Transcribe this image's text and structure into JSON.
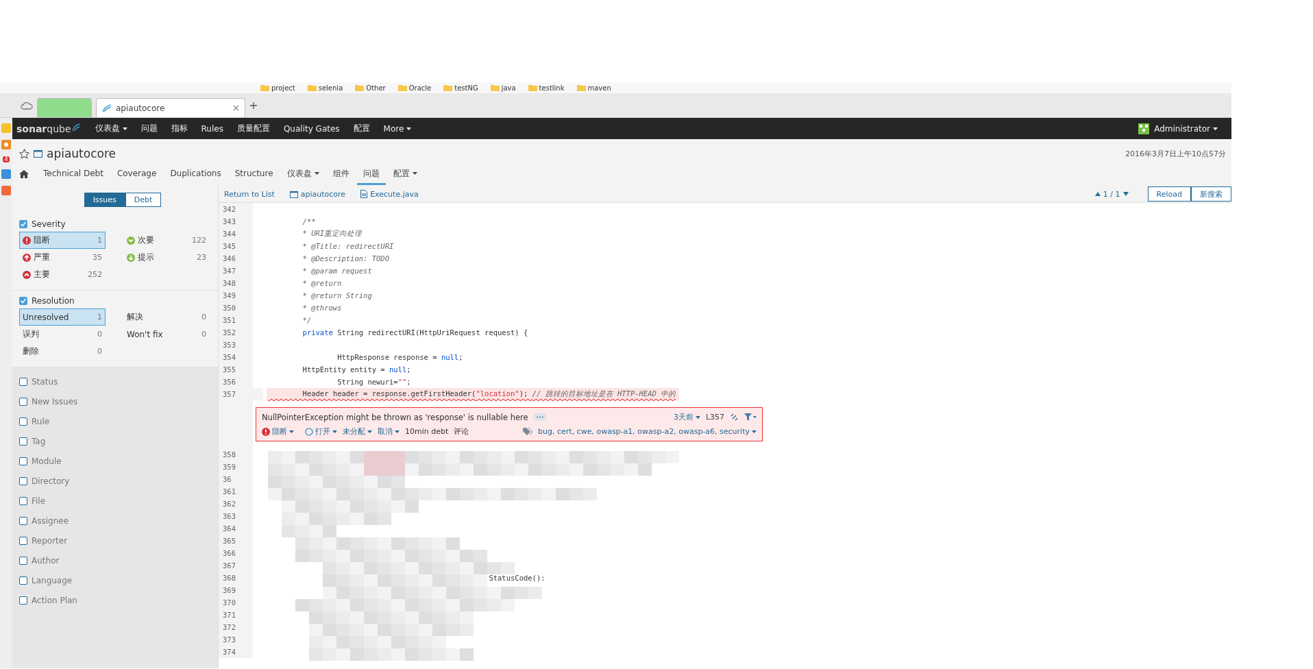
{
  "browser": {
    "bookmarks": [
      "project",
      "selenia",
      "Other",
      "Oracle",
      "testNG",
      "java",
      "testlink",
      "maven"
    ],
    "tabs": [
      {
        "selected": false
      },
      {
        "label": "apiautocore",
        "selected": true
      }
    ],
    "side_badge": "4"
  },
  "navbar": {
    "logo": "**sonar**qube",
    "items": [
      {
        "label": "仪表盘",
        "dropdown": true
      },
      {
        "label": "问题",
        "dropdown": false
      },
      {
        "label": "指标",
        "dropdown": false
      },
      {
        "label": "Rules",
        "dropdown": false
      },
      {
        "label": "质量配置",
        "dropdown": false
      },
      {
        "label": "Quality Gates",
        "dropdown": false
      },
      {
        "label": "配置",
        "dropdown": false
      },
      {
        "label": "More",
        "dropdown": true
      }
    ],
    "user": "Administrator"
  },
  "project": {
    "name": "apiautocore",
    "date": "2016年3月7日上午10点57分",
    "tabs": [
      {
        "label": "Technical Debt",
        "selected": false,
        "dropdown": false
      },
      {
        "label": "Coverage",
        "selected": false,
        "dropdown": false
      },
      {
        "label": "Duplications",
        "selected": false,
        "dropdown": false
      },
      {
        "label": "Structure",
        "selected": false,
        "dropdown": false
      },
      {
        "label": "仪表盘",
        "selected": false,
        "dropdown": true
      },
      {
        "label": "组件",
        "selected": false,
        "dropdown": false
      },
      {
        "label": "问题",
        "selected": true,
        "dropdown": false
      },
      {
        "label": "配置",
        "selected": false,
        "dropdown": true
      }
    ]
  },
  "sidebar": {
    "toggle": [
      {
        "label": "Issues",
        "selected": true
      },
      {
        "label": "Debt",
        "selected": false
      }
    ],
    "facets": [
      {
        "label": "Severity",
        "checked": true,
        "items": [
          {
            "label": "阻断",
            "count": "1",
            "selected": true,
            "kind": "blocker"
          },
          {
            "label": "次要",
            "count": "122",
            "selected": false,
            "kind": "minor"
          },
          {
            "label": "严重",
            "count": "35",
            "selected": false,
            "kind": "critical"
          },
          {
            "label": "提示",
            "count": "23",
            "selected": false,
            "kind": "info"
          },
          {
            "label": "主要",
            "count": "252",
            "selected": false,
            "kind": "major"
          }
        ]
      },
      {
        "label": "Resolution",
        "checked": true,
        "items": [
          {
            "label": "Unresolved",
            "count": "1",
            "selected": true
          },
          {
            "label": "解决",
            "count": "0",
            "selected": false
          },
          {
            "label": "误判",
            "count": "0",
            "selected": false
          },
          {
            "label": "Won't fix",
            "count": "0",
            "selected": false
          },
          {
            "label": "删除",
            "count": "0",
            "selected": false
          }
        ]
      },
      {
        "label": "Status",
        "checked": false
      },
      {
        "label": "New Issues",
        "checked": false
      },
      {
        "label": "Rule",
        "checked": false
      },
      {
        "label": "Tag",
        "checked": false
      },
      {
        "label": "Module",
        "checked": false
      },
      {
        "label": "Directory",
        "checked": false
      },
      {
        "label": "File",
        "checked": false
      },
      {
        "label": "Assignee",
        "checked": false
      },
      {
        "label": "Reporter",
        "checked": false
      },
      {
        "label": "Author",
        "checked": false
      },
      {
        "label": "Language",
        "checked": false
      },
      {
        "label": "Action Plan",
        "checked": false
      }
    ]
  },
  "toolbar": {
    "back": "Return to List",
    "project": "apiautocore",
    "file": "Execute.java",
    "pager": "1 / 1",
    "buttons": [
      "Reload",
      "新搜索"
    ]
  },
  "code": {
    "before": [
      {
        "number": "342"
      },
      {
        "number": "343",
        "tokens": [
          {
            "text": "        /**",
            "kind": "comment"
          }
        ]
      },
      {
        "number": "344",
        "tokens": [
          {
            "text": "        * URI重定向处理",
            "kind": "comment"
          }
        ]
      },
      {
        "number": "345",
        "tokens": [
          {
            "text": "        * @Title: redirectURI",
            "kind": "comment"
          }
        ]
      },
      {
        "number": "346",
        "tokens": [
          {
            "text": "        * @Description: TODO",
            "kind": "comment"
          }
        ]
      },
      {
        "number": "347",
        "tokens": [
          {
            "text": "        * @param request",
            "kind": "comment"
          }
        ]
      },
      {
        "number": "348",
        "tokens": [
          {
            "text": "        * @return",
            "kind": "comment"
          }
        ]
      },
      {
        "number": "349",
        "tokens": [
          {
            "text": "        * @return String",
            "kind": "comment"
          }
        ]
      },
      {
        "number": "350",
        "tokens": [
          {
            "text": "        * @throws",
            "kind": "comment"
          }
        ]
      },
      {
        "number": "351",
        "tokens": [
          {
            "text": "        */",
            "kind": "comment"
          }
        ]
      },
      {
        "number": "352",
        "tokens": [
          {
            "text": "        private",
            "kind": "keyword"
          },
          {
            "text": " String redirectURI(HttpUriRequest request) {",
            "kind": "plain"
          }
        ]
      },
      {
        "number": "353"
      },
      {
        "number": "354",
        "tokens": [
          {
            "text": "                HttpResponse response = ",
            "kind": "plain"
          },
          {
            "text": "null",
            "kind": "keyword"
          },
          {
            "text": ";",
            "kind": "plain"
          }
        ]
      },
      {
        "number": "355",
        "tokens": [
          {
            "text": "        HttpEntity entity = ",
            "kind": "plain"
          },
          {
            "text": "null",
            "kind": "keyword"
          },
          {
            "text": ";",
            "kind": "plain"
          }
        ]
      },
      {
        "number": "356",
        "tokens": [
          {
            "text": "                String newuri=",
            "kind": "plain"
          },
          {
            "text": "\"\"",
            "kind": "string"
          },
          {
            "text": ";",
            "kind": "plain"
          }
        ]
      },
      {
        "number": "357",
        "highlight": true,
        "tokens": [
          {
            "text": "        Header header = response.getFirstHeader(",
            "kind": "plain"
          },
          {
            "text": "\"location\"",
            "kind": "string"
          },
          {
            "text": "); ",
            "kind": "plain"
          },
          {
            "text": "// 跳转的目标地址是在 HTTP-HEAD 中的",
            "kind": "comment"
          }
        ]
      }
    ],
    "issue": {
      "message": "NullPointerException might be thrown as 'response' is nullable here",
      "age": "3天前",
      "line": "L357",
      "severity": {
        "label": "阻断",
        "kind": "blocker"
      },
      "status": "打开",
      "assignee": "未分配",
      "plan": "取消",
      "debt": "10min debt",
      "comment": "评论",
      "tags": "bug, cert, cwe, owasp-a1, owasp-a2, owasp-a6, security"
    },
    "after": [
      {
        "number": "358"
      },
      {
        "number": "359"
      },
      {
        "number": "36"
      },
      {
        "number": "361"
      },
      {
        "number": "362"
      },
      {
        "number": "363"
      },
      {
        "number": "364"
      },
      {
        "number": "365"
      },
      {
        "number": "366"
      },
      {
        "number": "367"
      },
      {
        "number": "368",
        "tokens": [
          {
            "text": "                                                   StatusCode():",
            "kind": "plain"
          }
        ]
      },
      {
        "number": "369"
      },
      {
        "number": "370"
      },
      {
        "number": "371"
      },
      {
        "number": "372"
      },
      {
        "number": "373"
      },
      {
        "number": "374"
      }
    ]
  }
}
